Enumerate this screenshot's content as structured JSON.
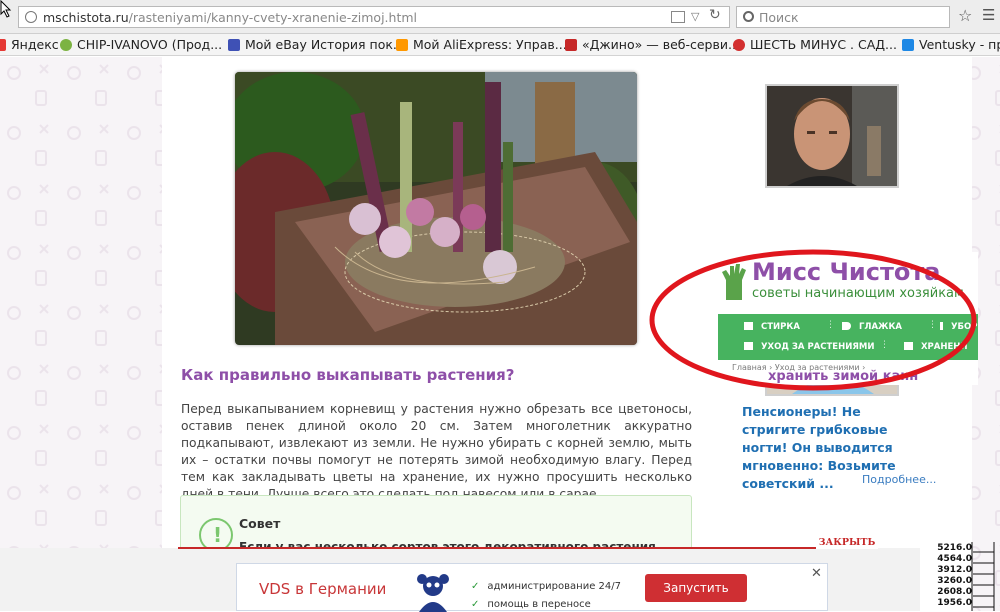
{
  "browser": {
    "url_domain": "mschistota.ru",
    "url_path": "/rasteniyami/kanny-cvety-xranenie-zimoj.html",
    "search_placeholder": "Поиск",
    "bookmarks": [
      {
        "label": "Яндекс",
        "color": "#e53935"
      },
      {
        "label": "CHIP-IVANOVO (Прод...",
        "color": "#7cb342"
      },
      {
        "label": "Мой eBay История пок...",
        "color": "#3f51b5"
      },
      {
        "label": "Мой AliExpress: Управ...",
        "color": "#ff9800"
      },
      {
        "label": "«Джино» — веб-серви...",
        "color": "#c62828"
      },
      {
        "label": "ШЕСТЬ МИНУС . САД...",
        "color": "#d32f2f"
      },
      {
        "label": "Ventusky - пр",
        "color": "#1e88e5"
      }
    ]
  },
  "article": {
    "heading": "Как правильно выкапывать растения?",
    "paragraph": "Перед выкапыванием корневищ у растения нужно обрезать все цветоносы, оставив пенек длиной около 20 см. Затем многолетник аккуратно подкапывают, извлекают из земли. Не нужно убирать с корней землю, мыть их – остатки почвы помогут не потерять зимой необходимую влагу. Перед тем как закладывать цветы на хранение, их нужно просушить несколько дней в тени. Лучше всего это сделать под навесом или в сарае.",
    "tip_title": "Совет",
    "tip_text": "Если у вас несколько сортов этого декоративного растения"
  },
  "sidebar": {
    "ad_title": "Пенсионеры! Не стригите грибковые ногти! Он выводится мгновенно: Возьмите советский ...",
    "ad_more": "Подробнее..."
  },
  "overlay": {
    "brand": "Мисс Чистота",
    "tagline": "советы начинающим хозяйкам",
    "menu": [
      "СТИРКА",
      "ГЛАЖКА",
      "УБОР",
      "УХОД ЗА РАСТЕНИЯМИ",
      "ХРАНЕНИ"
    ],
    "breadcrumb": "Главная  ›  Уход за растениями  ›",
    "ghost_heading": "хранить зимой канн"
  },
  "bottom_ad": {
    "close_label": "ЗАКРЫТЬ",
    "title": "VDS в Германии",
    "features": [
      "администрирование 24/7",
      "помощь в переносе"
    ],
    "button": "Запустить"
  },
  "ticker": [
    "5216.0",
    "4564.0",
    "3912.0",
    "3260.0",
    "2608.0",
    "1956.0"
  ],
  "colors": {
    "accent_purple": "#8e4fa8",
    "menu_green": "#47b35f",
    "ring_red": "#e0161d",
    "link_blue": "#1f6fb2"
  }
}
